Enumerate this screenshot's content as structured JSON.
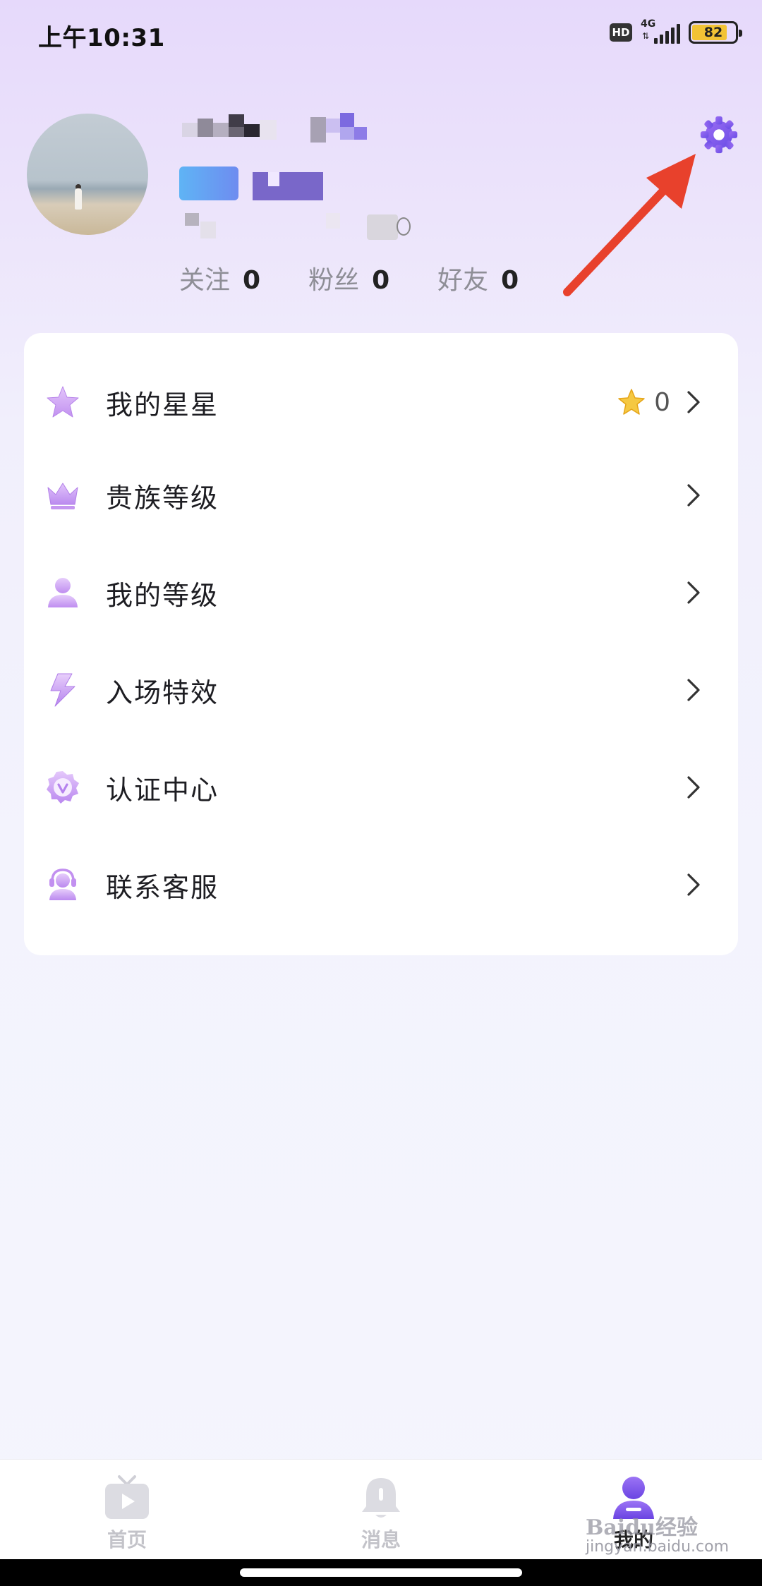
{
  "status_bar": {
    "time": "上午10:31",
    "hd": "HD",
    "network": "4G",
    "battery": "82"
  },
  "profile": {
    "stats": [
      {
        "label": "关注",
        "value": "0"
      },
      {
        "label": "粉丝",
        "value": "0"
      },
      {
        "label": "好友",
        "value": "0"
      }
    ]
  },
  "menu": {
    "items": [
      {
        "label": "我的星星",
        "icon": "star-icon",
        "extra_value": "0"
      },
      {
        "label": "贵族等级",
        "icon": "crown-icon"
      },
      {
        "label": "我的等级",
        "icon": "user-icon"
      },
      {
        "label": "入场特效",
        "icon": "lightning-icon"
      },
      {
        "label": "认证中心",
        "icon": "verified-badge-icon"
      },
      {
        "label": "联系客服",
        "icon": "customer-service-icon"
      }
    ]
  },
  "bottom_nav": {
    "items": [
      {
        "label": "首页",
        "icon": "tv-icon",
        "active": false
      },
      {
        "label": "消息",
        "icon": "bell-icon",
        "active": false
      },
      {
        "label": "我的",
        "icon": "profile-icon",
        "active": true
      }
    ]
  },
  "watermark": {
    "text": "Baidu经验",
    "sub": "jingyan.baidu.com"
  },
  "colors": {
    "accent": "#7b5cf0",
    "icon_purple": "#c89ef2",
    "annotation_red": "#e8412c"
  }
}
